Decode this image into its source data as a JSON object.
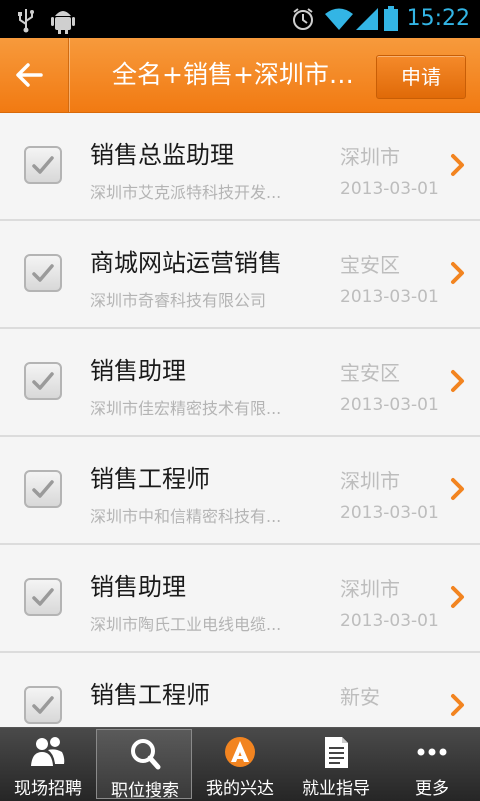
{
  "status_bar": {
    "time": "15:22",
    "icons": [
      "usb-icon",
      "android-debug-icon",
      "alarm-icon",
      "wifi-icon",
      "signal-icon",
      "battery-icon"
    ]
  },
  "title_bar": {
    "back_icon": "back-arrow-icon",
    "title": "全名+销售+深圳市+...",
    "apply_label": "申请"
  },
  "colors": {
    "accent": "#f28420",
    "time_color": "#33b5e5"
  },
  "jobs": [
    {
      "title": "销售总监助理",
      "company": "深圳市艾克派特科技开发...",
      "location": "深圳市",
      "date": "2013-03-01",
      "checked": true
    },
    {
      "title": "商城网站运营销售",
      "company": "深圳市奇睿科技有限公司",
      "location": "宝安区",
      "date": "2013-03-01",
      "checked": true
    },
    {
      "title": "销售助理",
      "company": "深圳市佳宏精密技术有限...",
      "location": "宝安区",
      "date": "2013-03-01",
      "checked": true
    },
    {
      "title": "销售工程师",
      "company": "深圳市中和信精密科技有...",
      "location": "深圳市",
      "date": "2013-03-01",
      "checked": true
    },
    {
      "title": "销售助理",
      "company": "深圳市陶氏工业电线电缆...",
      "location": "深圳市",
      "date": "2013-03-01",
      "checked": true
    },
    {
      "title": "销售工程师",
      "company": "",
      "location": "新安",
      "date": "",
      "checked": true
    }
  ],
  "bottom_nav": {
    "items": [
      {
        "label": "现场招聘",
        "icon": "people-icon",
        "active": false
      },
      {
        "label": "职位搜索",
        "icon": "search-icon",
        "active": true
      },
      {
        "label": "我的兴达",
        "icon": "brand-logo-icon",
        "active": false
      },
      {
        "label": "就业指导",
        "icon": "document-icon",
        "active": false
      },
      {
        "label": "更多",
        "icon": "more-icon",
        "active": false
      }
    ]
  }
}
